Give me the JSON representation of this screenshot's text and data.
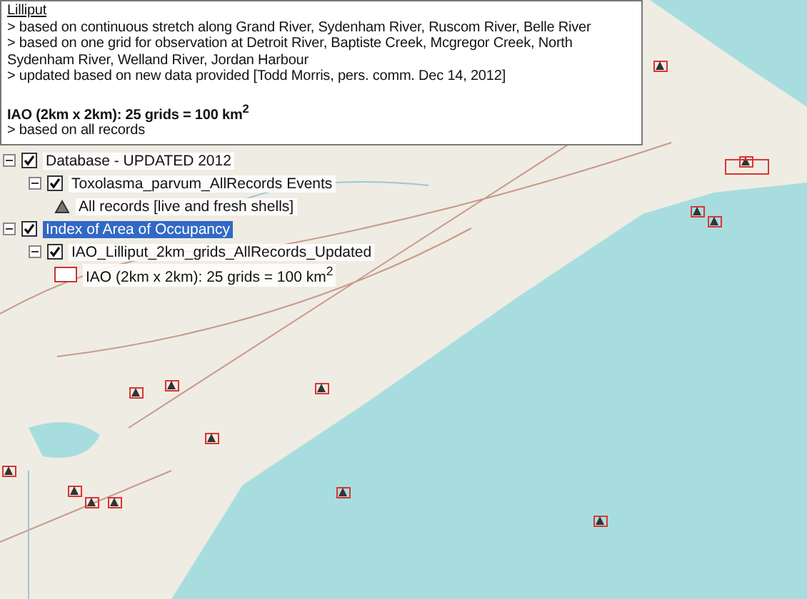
{
  "note": {
    "title": "Lilliput",
    "lines": [
      "> based on continuous stretch along Grand River, Sydenham River, Ruscom River, Belle River",
      "> based on one grid for observation at Detroit River, Baptiste Creek, Mcgregor Creek, North Sydenham River, Welland River, Jordan Harbour",
      "> updated based on new data provided [Todd Morris, pers. comm. Dec 14, 2012]"
    ],
    "heading": "IAO (2km x 2km): 25 grids = 100 km$^{2}$",
    "footer": "> based on all records"
  },
  "layers": [
    {
      "label": "Database - UPDATED 2012",
      "checked": true,
      "expanded": true,
      "selected": false,
      "children": [
        {
          "label": "Toxolasma_parvum_AllRecords Events",
          "checked": true,
          "expanded": true,
          "selected": false,
          "symbols": [
            {
              "kind": "triangle",
              "label": "All records [live and fresh shells]"
            }
          ]
        }
      ]
    },
    {
      "label": "Index of Area of Occupancy",
      "checked": true,
      "expanded": true,
      "selected": true,
      "children": [
        {
          "label": "IAO_Lilliput_2km_grids_AllRecords_Updated",
          "checked": true,
          "expanded": true,
          "selected": false,
          "symbols": [
            {
              "kind": "square",
              "label": "IAO (2km x 2km): 25 grids = 100 km$^{2}$"
            }
          ]
        }
      ]
    }
  ]
}
